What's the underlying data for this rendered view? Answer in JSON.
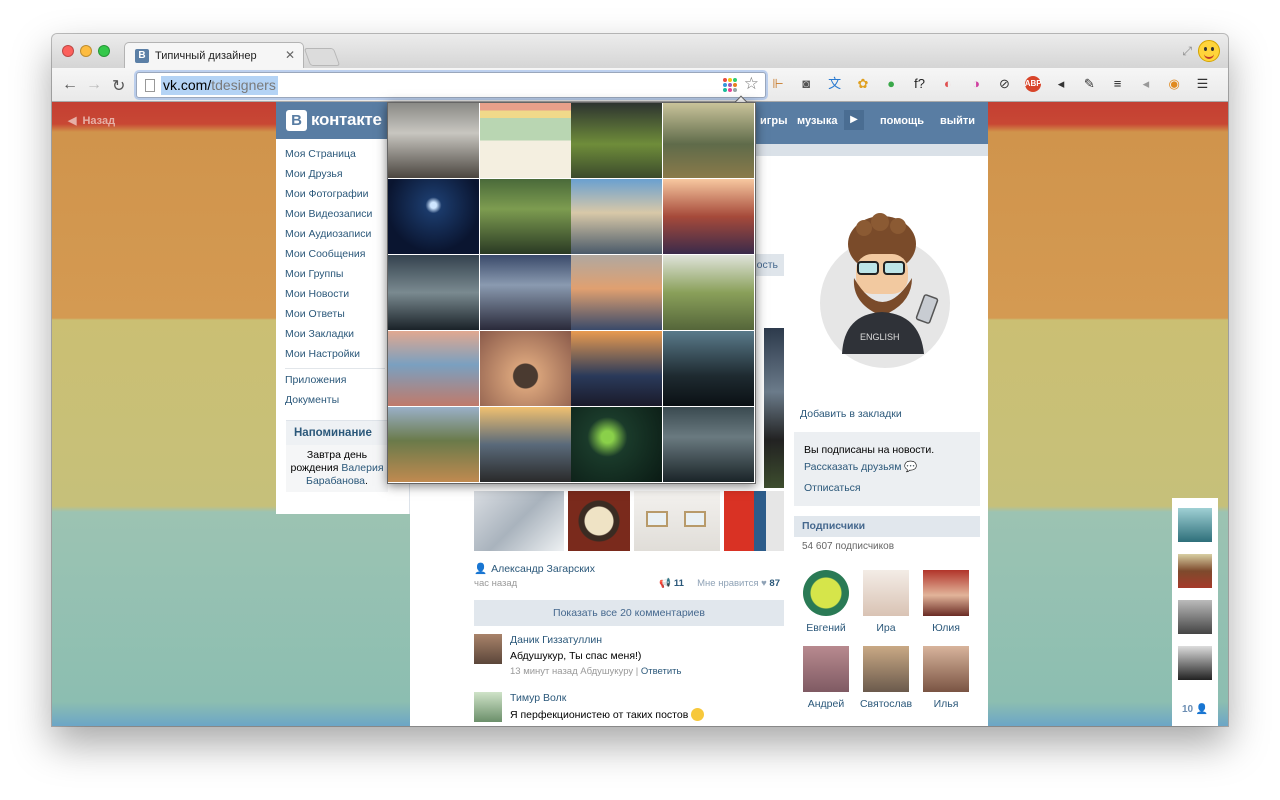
{
  "browser": {
    "tab_title": "Типичный дизайнер",
    "tab_favicon": "B",
    "url_host": "vk.com/",
    "url_path": "tdesigners",
    "extension_icons": [
      "bookmark-icon",
      "pocket-icon",
      "translate-icon",
      "puzzle-icon",
      "leaf-icon",
      "fx-icon",
      "color-wheel-icon",
      "color-wheel-icon",
      "sync-icon",
      "adblock-icon",
      "speaker-icon",
      "eyedropper-icon",
      "layers-icon",
      "volume-icon",
      "firefox-icon",
      "menu-icon"
    ],
    "extension_glyphs": [
      "⊩",
      "◙",
      "文",
      "✿",
      "●",
      "f?",
      "◐",
      "◑",
      "⊘",
      "ABP",
      "◂",
      "✎",
      "≡",
      "◂",
      "◉",
      "☰"
    ]
  },
  "page": {
    "back_label": "Назад",
    "logo_letter": "В",
    "logo_text": "контакте",
    "top_nav": [
      "игры",
      "музыка",
      "помощь",
      "выйти"
    ],
    "left_menu": [
      "Моя Страница",
      "Мои Друзья",
      "Мои Фотографии",
      "Мои Видеозаписи",
      "Мои Аудиозаписи",
      "Мои Сообщения",
      "Мои Группы",
      "Мои Новости",
      "Мои Ответы",
      "Мои Закладки",
      "Мои Настройки"
    ],
    "left_menu_extra": [
      "Приложения",
      "Документы"
    ],
    "reminder": {
      "title": "Напоминание",
      "text_before": "Завтра день рождения ",
      "person": "Валерия Барабанова",
      "text_after": "."
    },
    "feed": {
      "author": "Александр Загарских",
      "time": "час назад",
      "reposts": "11",
      "likes_label": "Мне нравится",
      "likes": "87",
      "show_all": "Показать все 20 комментариев",
      "comments": [
        {
          "name": "Даник Гиззатуллин",
          "text": "Абдушукур, Ты спас меня!)",
          "meta": "13 минут назад Абдушукуру",
          "reply": "Ответить"
        },
        {
          "name": "Тимур Волк",
          "text": "Я перфекционистею от таких постов",
          "meta": "",
          "reply": ""
        }
      ],
      "partial_label": "ость"
    },
    "right": {
      "bookmark": "Добавить в закладки",
      "subscribed": "Вы подписаны на новости.",
      "tell_friends": "Рассказать друзьям",
      "unsubscribe": "Отписаться",
      "subs_title": "Подписчики",
      "subs_count": "54 607 подписчиков",
      "people": [
        "Евгений",
        "Ира",
        "Юлия",
        "Андрей",
        "Святослав",
        "Илья"
      ]
    },
    "side_friends_count": "10"
  },
  "colors": {
    "vk_blue": "#597da3",
    "link": "#2b587a"
  }
}
